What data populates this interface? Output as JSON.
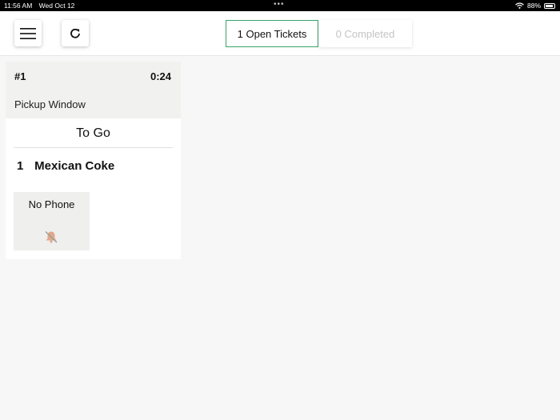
{
  "status_bar": {
    "time": "11:56 AM",
    "date": "Wed Oct 12",
    "dots": "•••",
    "battery": "88%",
    "icons": [
      "wifi-icon",
      "battery-icon"
    ]
  },
  "toolbar": {
    "menu_icon": "hamburger-menu-icon",
    "refresh_icon": "refresh-icon"
  },
  "tabs": [
    {
      "label": "1 Open Tickets",
      "active": true
    },
    {
      "label": "0 Completed",
      "active": false
    }
  ],
  "ticket": {
    "number": "#1",
    "elapsed": "0:24",
    "location": "Pickup Window",
    "order_type": "To Go",
    "items": [
      {
        "qty": "1",
        "name": "Mexican Coke"
      }
    ],
    "phone_button": {
      "label": "No Phone",
      "icon": "bell-off-icon"
    }
  },
  "colors": {
    "accent": "#3aa36b",
    "bell": "#e0a98a"
  }
}
